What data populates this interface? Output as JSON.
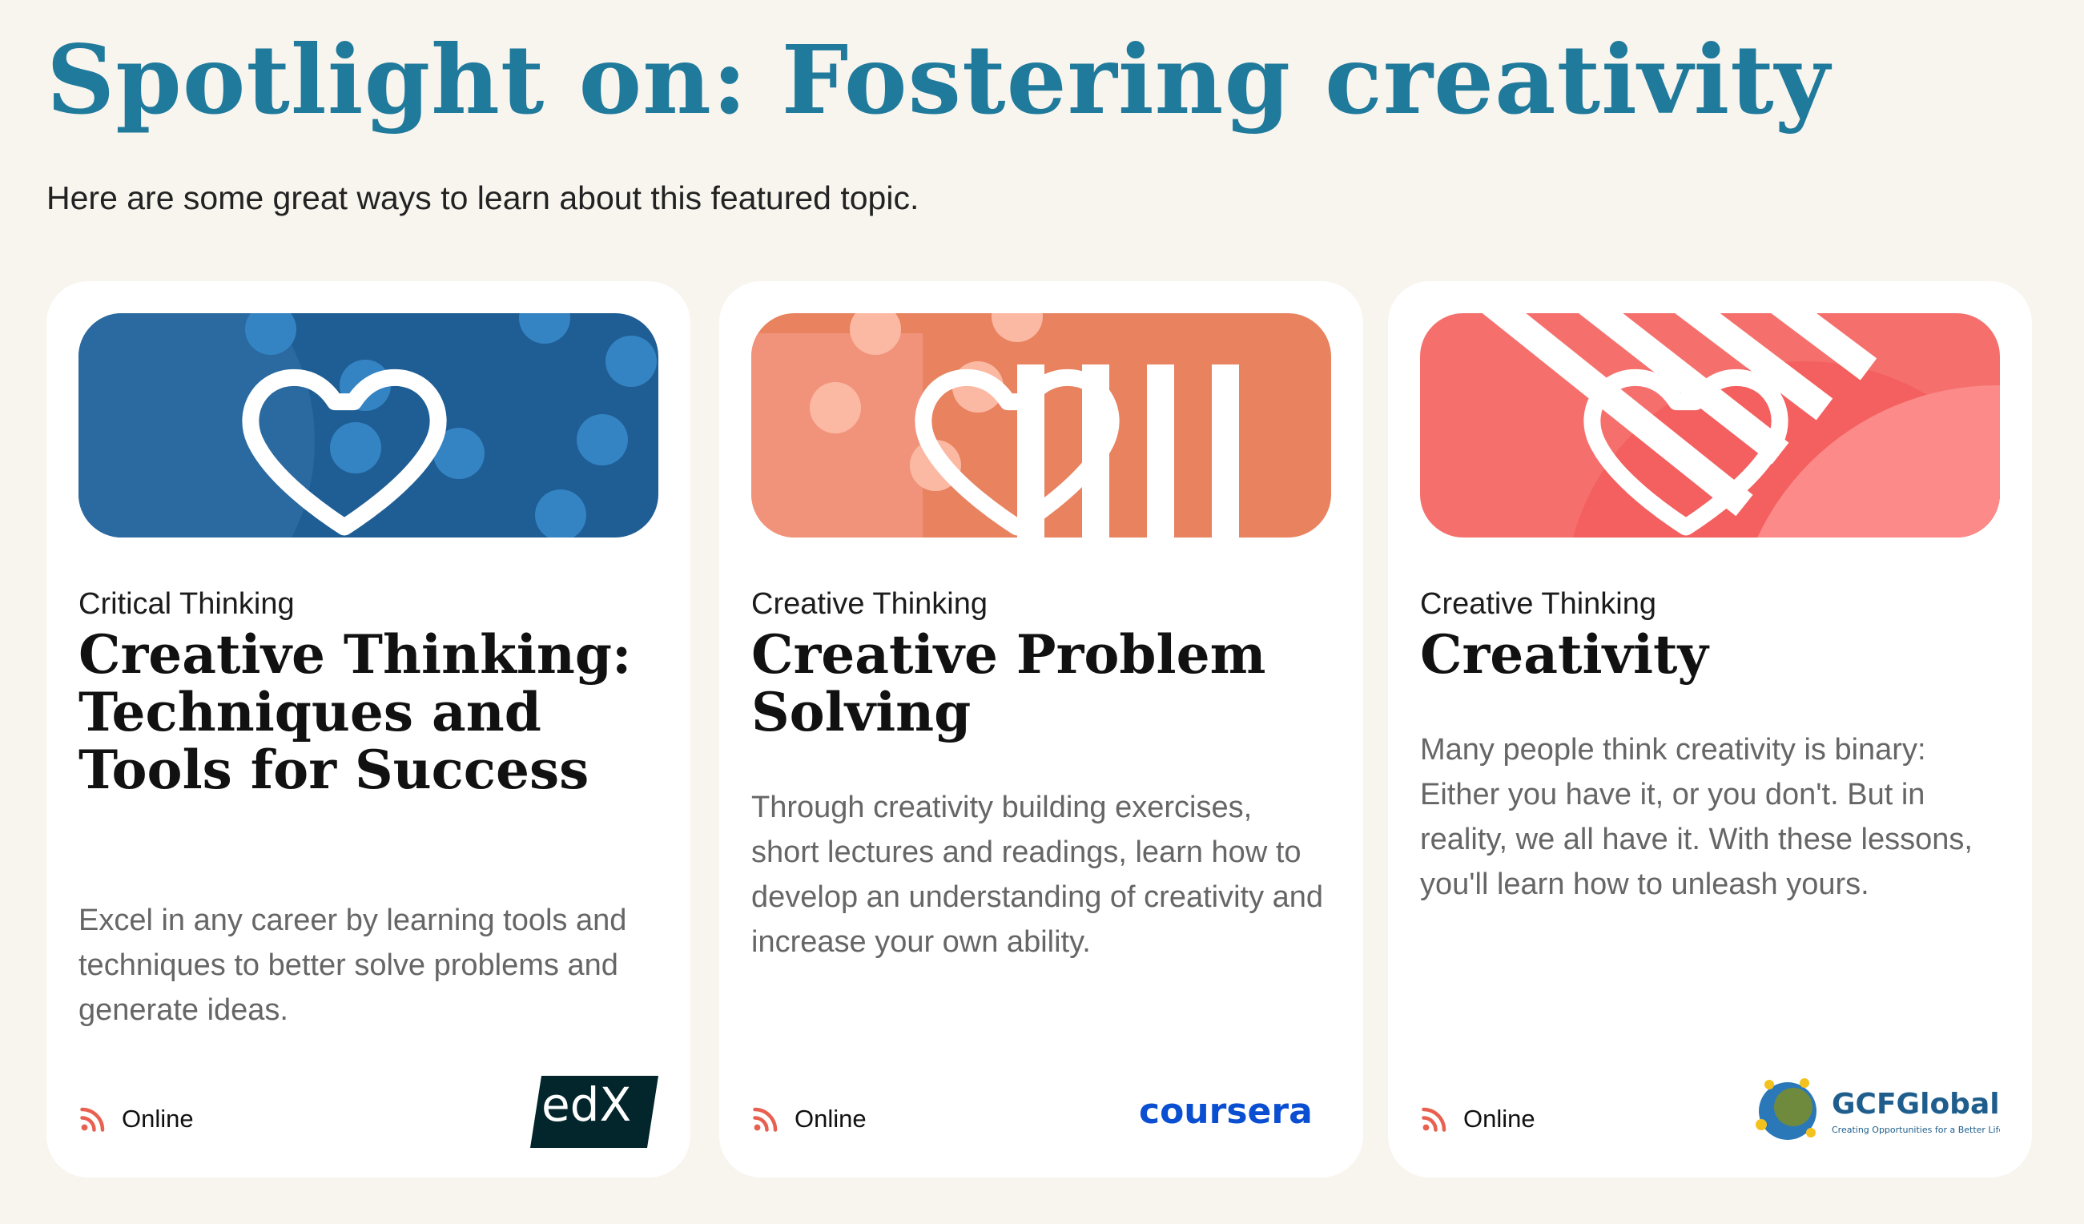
{
  "page": {
    "title": "Spotlight on: Fostering creativity",
    "subtitle": "Here are some great ways to learn about this featured topic."
  },
  "cards": [
    {
      "category": "Critical Thinking",
      "title": "Creative Thinking: Techniques and Tools for Success",
      "description": "Excel in any career by learning tools and techniques to better solve problems and generate ideas.",
      "format": "Online",
      "provider": "edX",
      "banner_color": "#1f5e94"
    },
    {
      "category": "Creative Thinking",
      "title": "Creative Problem Solving",
      "description": "Through creativity building exercises, short lectures and readings, learn how to develop an understanding of creativity and increase your own ability.",
      "format": "Online",
      "provider": "coursera",
      "banner_color": "#e8825f"
    },
    {
      "category": "Creative Thinking",
      "title": "Creativity",
      "description": "Many people think creativity is binary: Either you have it, or you don't. But in reality, we all have it. With these lessons, you'll learn how to unleash yours.",
      "format": "Online",
      "provider": "GCFGlobal",
      "provider_tagline": "Creating Opportunities for a Better Life",
      "banner_color": "#f5706d"
    }
  ],
  "icons": {
    "favorite": "heart-icon",
    "format": "online-broadcast-icon"
  },
  "colors": {
    "title": "#1f7a9c",
    "background": "#f8f4ee",
    "online_icon": "#e8604f"
  }
}
